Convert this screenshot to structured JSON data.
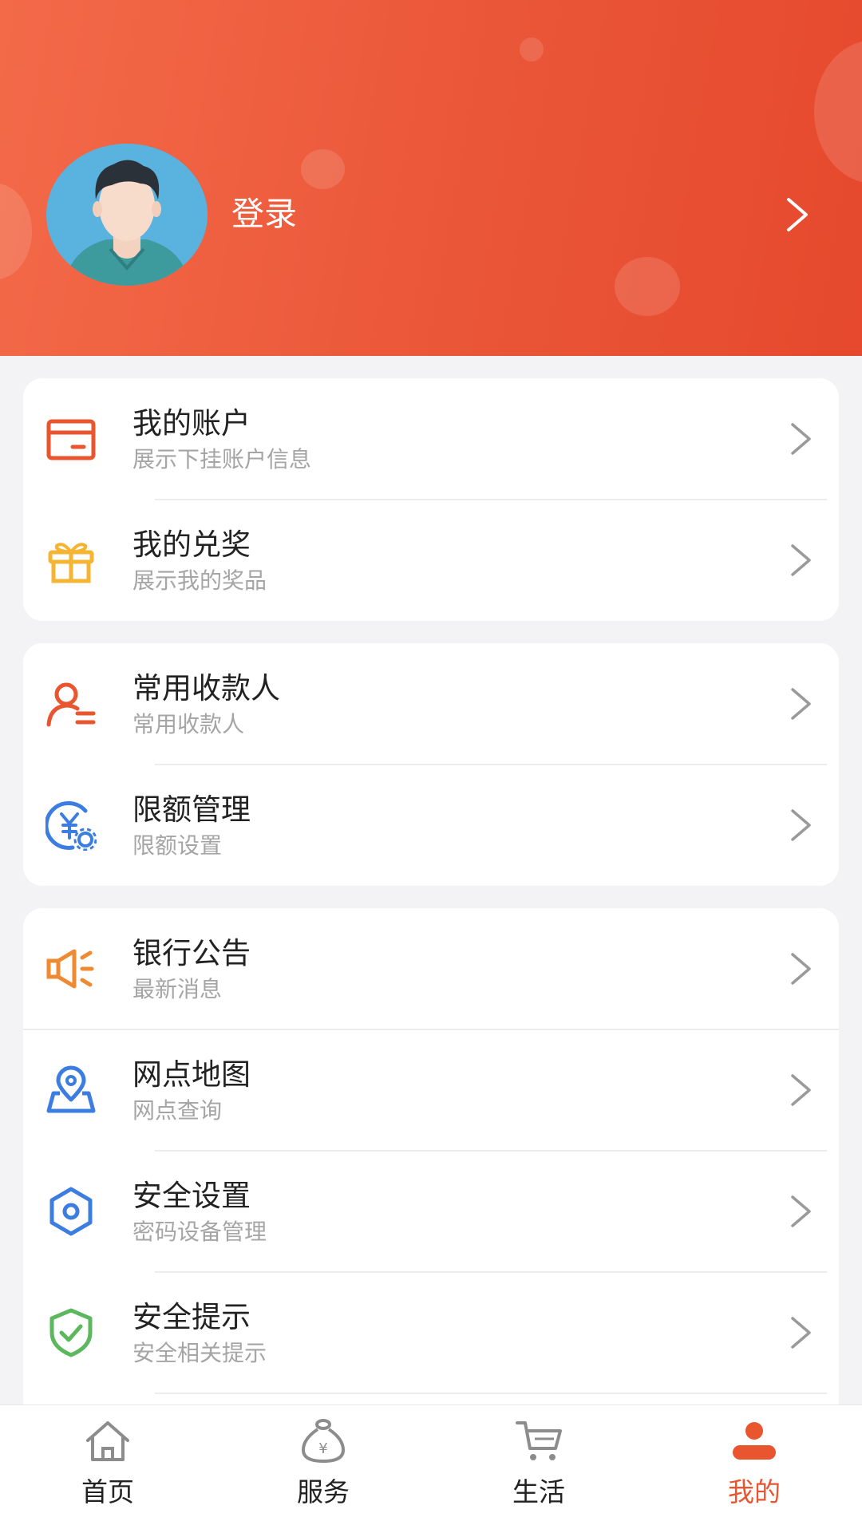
{
  "header": {
    "login_label": "登录"
  },
  "groups": [
    {
      "items": [
        {
          "title": "我的账户",
          "subtitle": "展示下挂账户信息",
          "icon": "card-icon",
          "color": "#e8552f"
        },
        {
          "title": "我的兑奖",
          "subtitle": "展示我的奖品",
          "icon": "gift-icon",
          "color": "#f5b533"
        }
      ]
    },
    {
      "items": [
        {
          "title": "常用收款人",
          "subtitle": "常用收款人",
          "icon": "payee-icon",
          "color": "#e8552f"
        },
        {
          "title": "限额管理",
          "subtitle": "限额设置",
          "icon": "limit-icon",
          "color": "#3b7de0"
        }
      ]
    },
    {
      "items": [
        {
          "title": "银行公告",
          "subtitle": "最新消息",
          "icon": "megaphone-icon",
          "color": "#f08a32"
        },
        {
          "title": "网点地图",
          "subtitle": "网点查询",
          "icon": "map-pin-icon",
          "color": "#3b7de0"
        },
        {
          "title": "安全设置",
          "subtitle": "密码设备管理",
          "icon": "hexagon-icon",
          "color": "#3b7de0"
        },
        {
          "title": "安全提示",
          "subtitle": "安全相关提示",
          "icon": "shield-check-icon",
          "color": "#5cb85c"
        }
      ]
    }
  ],
  "tabbar": [
    {
      "label": "首页",
      "icon": "home-icon",
      "active": false
    },
    {
      "label": "服务",
      "icon": "money-bag-icon",
      "active": false
    },
    {
      "label": "生活",
      "icon": "cart-icon",
      "active": false
    },
    {
      "label": "我的",
      "icon": "user-icon",
      "active": true
    }
  ],
  "colors": {
    "accent": "#e8552f",
    "header_start": "#f36a49",
    "header_end": "#e6492d"
  }
}
